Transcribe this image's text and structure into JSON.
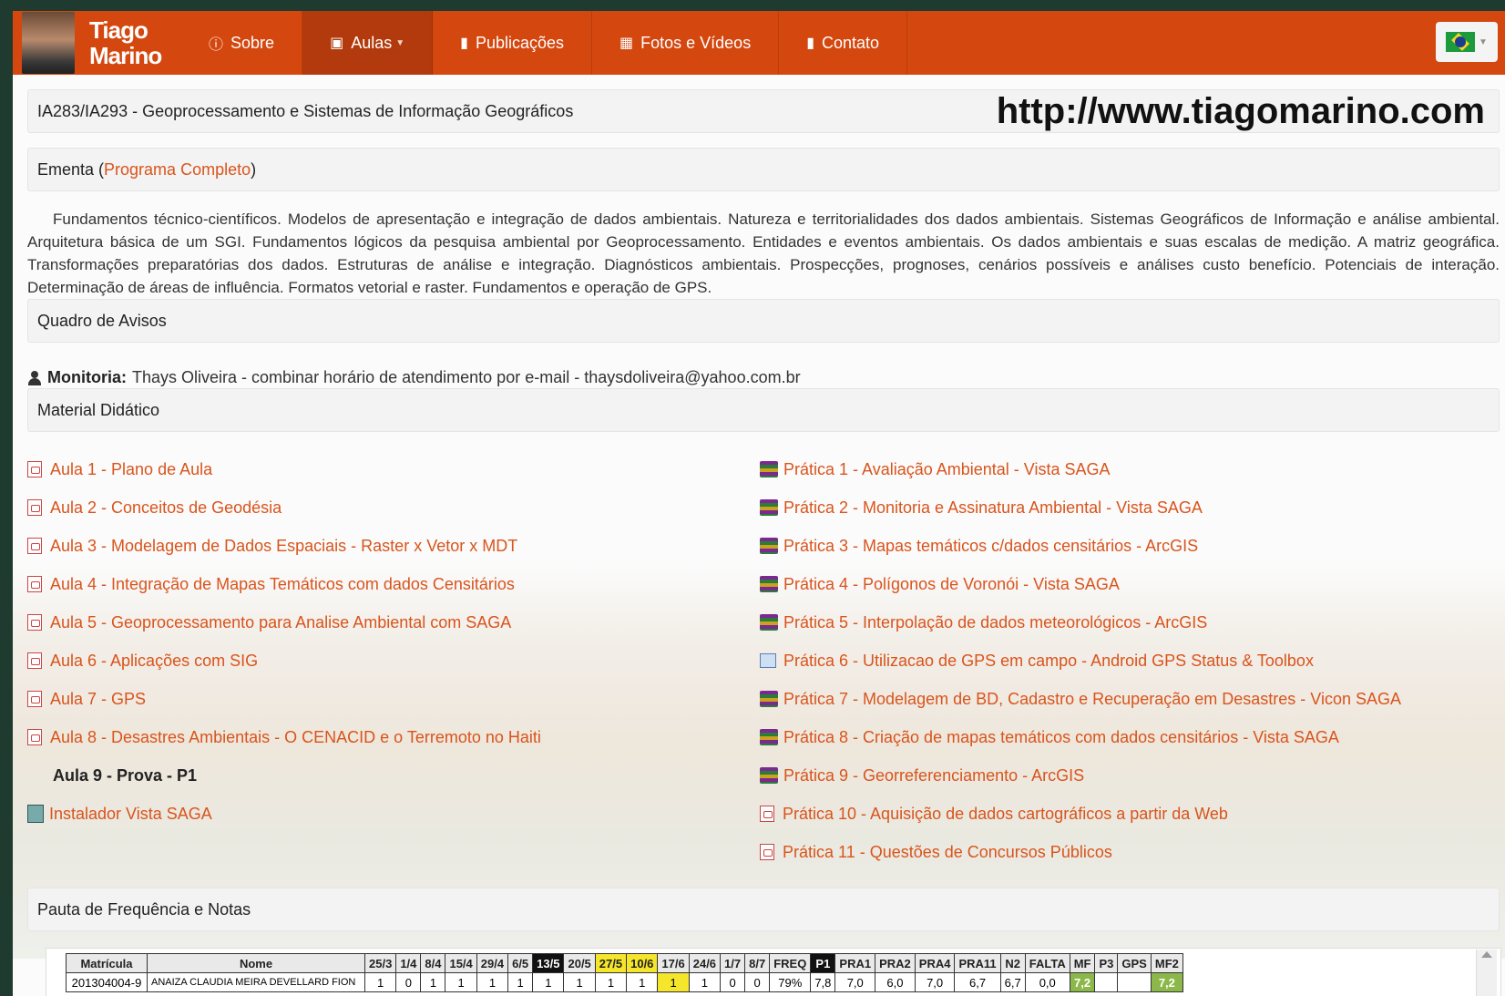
{
  "brand": {
    "line1": "Tiago",
    "line2": "Marino"
  },
  "nav": [
    {
      "label": "Sobre",
      "icon": "info-icon"
    },
    {
      "label": "Aulas",
      "icon": "book-icon"
    },
    {
      "label": "Publicações",
      "icon": "document-icon"
    },
    {
      "label": "Fotos e Vídeos",
      "icon": "film-icon"
    },
    {
      "label": "Contato",
      "icon": "comment-icon"
    }
  ],
  "course_title": "IA283/IA293 - Geoprocessamento e Sistemas de Informação Geográficos",
  "url": "http://www.tiagomarino.com",
  "ementa": {
    "label_prefix": "Ementa (",
    "link": "Programa Completo",
    "label_suffix": ")"
  },
  "ementa_text": "Fundamentos técnico-científicos. Modelos de apresentação e integração de dados ambientais. Natureza e territorialidades dos dados ambientais. Sistemas Geográficos de Informação e análise ambiental. Arquitetura básica de um SGI. Fundamentos lógicos da pesquisa ambiental por Geoprocessamento. Entidades e eventos ambientais. Os dados ambientais e suas escalas de medição. A matriz geográfica. Transformações preparatórias dos dados. Estruturas de análise e integração. Diagnósticos ambientais. Prospecções, prognoses, cenários possíveis e análises custo benefício. Potenciais de interação. Determinação de áreas de influência. Formatos vetorial e raster. Fundamentos e operação de GPS.",
  "avisos_title": "Quadro de Avisos",
  "monitoria": {
    "label": "Monitoria:",
    "text": "Thays Oliveira - combinar horário de atendimento por e-mail - thaysdoliveira@yahoo.com.br"
  },
  "material_title": "Material Didático",
  "aulas": [
    "Aula 1 - Plano de Aula",
    "Aula 2 - Conceitos de Geodésia",
    "Aula 3 - Modelagem de Dados Espaciais - Raster x Vetor x MDT",
    "Aula 4 - Integração de Mapas Temáticos com dados Censitários",
    "Aula 5 - Geoprocessamento para Analise Ambiental com SAGA",
    "Aula 6 - Aplicações com SIG",
    "Aula 7 - GPS",
    "Aula 8 - Desastres Ambientais - O CENACID e o Terremoto no Haiti"
  ],
  "aula9": "Aula 9 - Prova - P1",
  "instalador": "Instalador Vista SAGA",
  "praticas": [
    "Prática 1 - Avaliação Ambiental - Vista SAGA",
    "Prática 2 - Monitoria e Assinatura Ambiental - Vista SAGA",
    "Prática 3 - Mapas temáticos c/dados censitários - ArcGIS",
    "Prática 4 - Polígonos de Voronói - Vista SAGA",
    "Prática 5 - Interpolação de dados meteorológicos - ArcGIS",
    "Prática 6 - Utilizacao de GPS em campo - Android GPS Status & Toolbox",
    "Prática 7 - Modelagem de BD, Cadastro e Recuperação em Desastres - Vicon SAGA",
    "Prática 8 - Criação de mapas temáticos com dados censitários - Vista SAGA",
    "Prática 9 - Georreferenciamento - ArcGIS",
    "Prática 10 - Aquisição de dados cartográficos a partir da Web",
    "Prática 11 - Questões de Concursos Públicos"
  ],
  "pauta_title": "Pauta de Frequência e Notas",
  "table": {
    "headers": [
      "Matrícula",
      "Nome",
      "25/3",
      "1/4",
      "8/4",
      "15/4",
      "29/4",
      "6/5",
      "13/5",
      "20/5",
      "27/5",
      "10/6",
      "17/6",
      "24/6",
      "1/7",
      "8/7",
      "FREQ",
      "P1",
      "PRA1",
      "PRA2",
      "PRA4",
      "PRA11",
      "N2",
      "FALTA",
      "MF",
      "P3",
      "GPS",
      "MF2"
    ],
    "header_styles": [
      "",
      "",
      "",
      "",
      "",
      "",
      "",
      "",
      "blk",
      "",
      "yel",
      "yel",
      "",
      "",
      "",
      "",
      "",
      "blk",
      "",
      "",
      "",
      "",
      "",
      "",
      "",
      "",
      "",
      ""
    ],
    "rows": [
      [
        "201304004-9",
        "ANAIZA CLAUDIA MEIRA DEVELLARD FION",
        "1",
        "0",
        "1",
        "1",
        "1",
        "1",
        "1",
        "1",
        "1",
        "1",
        "1",
        "1",
        "0",
        "0",
        "79%",
        "7,8",
        "7,0",
        "6,0",
        "7,0",
        "6,7",
        "6,7",
        "0,0",
        "7,2",
        "",
        "",
        "7,2"
      ]
    ],
    "row_styles": [
      "",
      "nm",
      "",
      "",
      "",
      "",
      "",
      "",
      "",
      "",
      "",
      "",
      "yel",
      "",
      "",
      "",
      "",
      "",
      "",
      "",
      "",
      "",
      "",
      "",
      "grn",
      "",
      "",
      "grn"
    ]
  }
}
